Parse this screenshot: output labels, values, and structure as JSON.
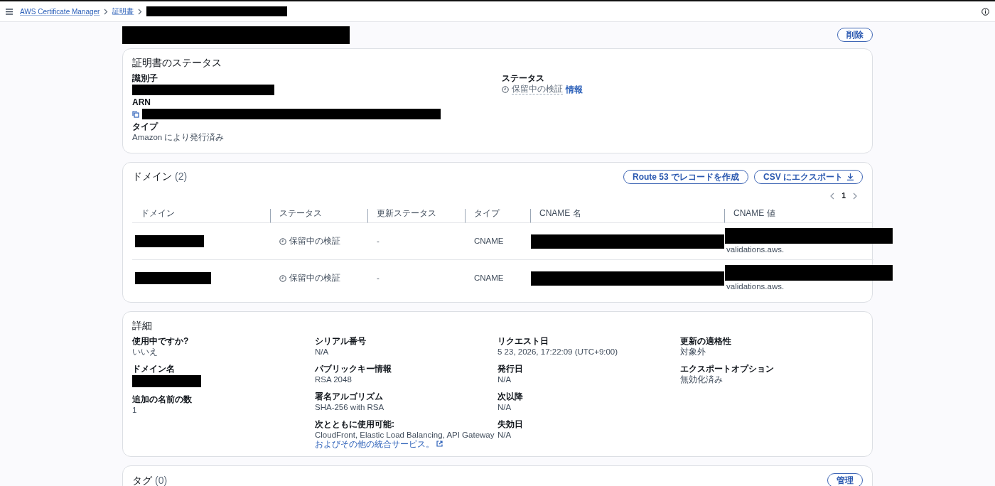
{
  "breadcrumbs": [
    {
      "kind": "link",
      "label": "AWS Certificate Manager"
    },
    {
      "kind": "link",
      "label": "証明書"
    },
    {
      "kind": "redacted"
    }
  ],
  "header": {
    "title_redacted": true,
    "delete_button": "削除"
  },
  "status_section": {
    "title": "証明書のステータス",
    "fields": [
      {
        "label": "識別子",
        "redacted": true
      },
      {
        "label": "ARN",
        "redacted": true,
        "copy": true
      },
      {
        "label": "タイプ",
        "value": "Amazon により発行済み"
      }
    ],
    "status": {
      "label": "ステータス",
      "value": "保留中の検証",
      "info_link": "情報"
    }
  },
  "domains": {
    "title": "ドメイン",
    "count": "(2)",
    "buttons": [
      {
        "label": "Route 53 でレコードを作成",
        "kind": "plain"
      },
      {
        "label": "CSV にエクスポート",
        "kind": "download"
      }
    ],
    "page": "1",
    "columns": [
      "ドメイン",
      "ステータス",
      "更新ステータス",
      "タイプ",
      "CNAME 名",
      "CNAME 値"
    ],
    "rows": [
      {
        "domain_redacted": true,
        "status": "保留中の検証",
        "renewal_status": "-",
        "type": "CNAME",
        "cname_name_redacted": true,
        "cname_value_redacted": true,
        "cname_value_tail": "validations.aws."
      },
      {
        "domain_redacted": true,
        "status": "保留中の検証",
        "renewal_status": "-",
        "type": "CNAME",
        "cname_name_redacted": true,
        "cname_value_redacted": true,
        "cname_value_tail": "validations.aws."
      }
    ]
  },
  "details": {
    "title": "詳細",
    "columns": [
      [
        {
          "label": "使用中ですか?",
          "value": "いいえ"
        },
        {
          "label": "ドメイン名",
          "redacted": true
        },
        {
          "label": "追加の名前の数",
          "value": "1"
        }
      ],
      [
        {
          "label": "シリアル番号",
          "value": "N/A"
        },
        {
          "label": "パブリックキー情報",
          "value": "RSA 2048"
        },
        {
          "label": "署名アルゴリズム",
          "value": "SHA-256 with RSA"
        },
        {
          "label": "次とともに使用可能:",
          "value": "CloudFront, Elastic Load Balancing, API Gateway",
          "link": "およびその他の統合サービス。"
        }
      ],
      [
        {
          "label": "リクエスト日",
          "value": "5 23, 2026, 17:22:09 (UTC+9:00)"
        },
        {
          "label": "発行日",
          "value": "N/A"
        },
        {
          "label": "次以降",
          "value": "N/A"
        },
        {
          "label": "失効日",
          "value": "N/A"
        }
      ],
      [
        {
          "label": "更新の適格性",
          "value": "対象外"
        },
        {
          "label": "エクスポートオプション",
          "value": "無効化済み"
        }
      ]
    ]
  },
  "tags": {
    "title": "タグ",
    "count": "(0)",
    "button": "管理"
  }
}
